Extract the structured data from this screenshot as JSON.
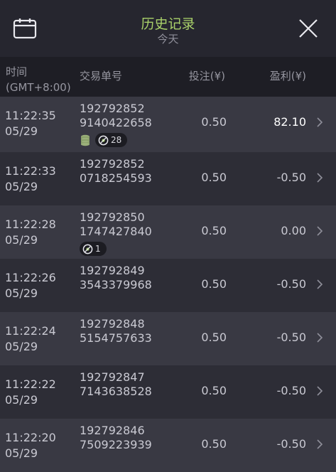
{
  "header": {
    "title": "历史记录",
    "subtitle": "今天"
  },
  "columns": {
    "time": "时间",
    "timezone": "(GMT+8:00)",
    "order": "交易单号",
    "bet": "投注(¥)",
    "profit": "盈利(¥)"
  },
  "rows": [
    {
      "time": "11:22:35",
      "date": "05/29",
      "order_line1": "192792852",
      "order_line2": "9140422658",
      "bet": "0.50",
      "profit": "82.10",
      "badge_count": "28"
    },
    {
      "time": "11:22:33",
      "date": "05/29",
      "order_line1": "192792852",
      "order_line2": "0718254593",
      "bet": "0.50",
      "profit": "-0.50"
    },
    {
      "time": "11:22:28",
      "date": "05/29",
      "order_line1": "192792850",
      "order_line2": "1747427840",
      "bet": "0.50",
      "profit": "0.00",
      "badge_count": "1"
    },
    {
      "time": "11:22:26",
      "date": "05/29",
      "order_line1": "192792849",
      "order_line2": "3543379968",
      "bet": "0.50",
      "profit": "-0.50"
    },
    {
      "time": "11:22:24",
      "date": "05/29",
      "order_line1": "192792848",
      "order_line2": "5154757633",
      "bet": "0.50",
      "profit": "-0.50"
    },
    {
      "time": "11:22:22",
      "date": "05/29",
      "order_line1": "192792847",
      "order_line2": "7143638528",
      "bet": "0.50",
      "profit": "-0.50"
    },
    {
      "time": "11:22:20",
      "date": "05/29",
      "order_line1": "192792846",
      "order_line2": "7509223939",
      "bet": "0.50",
      "profit": "-0.50"
    }
  ],
  "colors": {
    "title": "#a9d16a",
    "win_profit": "#ffffff",
    "background": "#26262f"
  },
  "icons": {
    "calendar": "calendar-icon",
    "close": "close-icon",
    "chevron": "chevron-right-icon",
    "coin": "coin-stack-icon",
    "bet": "bet-count-icon"
  }
}
